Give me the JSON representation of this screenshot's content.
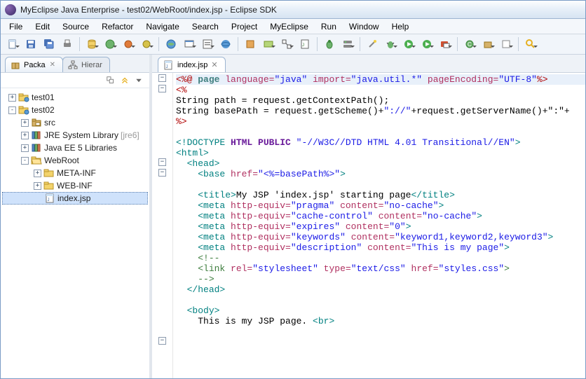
{
  "title": "MyEclipse Java Enterprise - test02/WebRoot/index.jsp - Eclipse SDK",
  "menu": [
    "File",
    "Edit",
    "Source",
    "Refactor",
    "Navigate",
    "Search",
    "Project",
    "MyEclipse",
    "Run",
    "Window",
    "Help"
  ],
  "sidebar": {
    "tabs": [
      {
        "label": "Packa",
        "icon": "package"
      },
      {
        "label": "Hierar",
        "icon": "hierarchy"
      }
    ],
    "tree": [
      {
        "depth": 0,
        "twisty": "+",
        "icon": "project",
        "label": "test01"
      },
      {
        "depth": 0,
        "twisty": "-",
        "icon": "project",
        "label": "test02"
      },
      {
        "depth": 1,
        "twisty": "+",
        "icon": "src",
        "label": "src"
      },
      {
        "depth": 1,
        "twisty": "+",
        "icon": "lib",
        "label": "JRE System Library",
        "suffix": "[jre6]"
      },
      {
        "depth": 1,
        "twisty": "+",
        "icon": "lib",
        "label": "Java EE 5 Libraries"
      },
      {
        "depth": 1,
        "twisty": "-",
        "icon": "folder-open",
        "label": "WebRoot"
      },
      {
        "depth": 2,
        "twisty": "+",
        "icon": "folder",
        "label": "META-INF"
      },
      {
        "depth": 2,
        "twisty": "+",
        "icon": "folder",
        "label": "WEB-INF"
      },
      {
        "depth": 2,
        "twisty": "",
        "icon": "jsp",
        "label": "index.jsp",
        "selected": true
      }
    ]
  },
  "editor": {
    "tab": {
      "label": "index.jsp",
      "icon": "jsp"
    },
    "folds": [
      "-",
      "-",
      "",
      "",
      "",
      "",
      "",
      "",
      "-",
      "-",
      "",
      "",
      "",
      "",
      "",
      "",
      "",
      "",
      "",
      "",
      "",
      "",
      "",
      "",
      "",
      "-",
      ""
    ],
    "lines": [
      {
        "hl": true,
        "segs": [
          [
            "<%@ ",
            "t-red"
          ],
          [
            "page ",
            "t-dir"
          ],
          [
            "language=",
            "t-attr"
          ],
          [
            "\"java\" ",
            "t-str"
          ],
          [
            "import=",
            "t-attr"
          ],
          [
            "\"java.util.*\" ",
            "t-str"
          ],
          [
            "pageEncoding=",
            "t-attr"
          ],
          [
            "\"UTF-8\"",
            "t-str"
          ],
          [
            "%>",
            "t-red"
          ]
        ]
      },
      {
        "segs": [
          [
            "<%",
            "t-red"
          ]
        ]
      },
      {
        "segs": [
          [
            "String path = request.getContextPath();",
            ""
          ]
        ]
      },
      {
        "segs": [
          [
            "String basePath = request.getScheme()+",
            ""
          ],
          [
            "\"://\"",
            "t-str"
          ],
          [
            "+request.getServerName()+",
            ""
          ],
          [
            "\":\"+",
            ""
          ]
        ]
      },
      {
        "segs": [
          [
            "%>",
            "t-red"
          ]
        ]
      },
      {
        "segs": [
          [
            "",
            ""
          ]
        ]
      },
      {
        "segs": [
          [
            "<!DOCTYPE ",
            "t-tag"
          ],
          [
            "HTML PUBLIC ",
            "t-key"
          ],
          [
            "\"-//W3C//DTD HTML 4.01 Transitional//EN\"",
            "t-str"
          ],
          [
            ">",
            "t-tag"
          ]
        ]
      },
      {
        "segs": [
          [
            "<html>",
            "t-tag"
          ]
        ]
      },
      {
        "segs": [
          [
            "  ",
            ""
          ],
          [
            "<head>",
            "t-tag"
          ]
        ]
      },
      {
        "segs": [
          [
            "    ",
            ""
          ],
          [
            "<base ",
            "t-tag"
          ],
          [
            "href=",
            "t-attr"
          ],
          [
            "\"<%=basePath%>\"",
            "t-str"
          ],
          [
            ">",
            "t-tag"
          ]
        ]
      },
      {
        "segs": [
          [
            "    ",
            ""
          ]
        ]
      },
      {
        "segs": [
          [
            "    ",
            ""
          ],
          [
            "<title>",
            "t-tag"
          ],
          [
            "My JSP 'index.jsp' starting page",
            ""
          ],
          [
            "</title>",
            "t-tag"
          ]
        ]
      },
      {
        "segs": [
          [
            "    ",
            ""
          ],
          [
            "<meta ",
            "t-tag"
          ],
          [
            "http-equiv=",
            "t-attr"
          ],
          [
            "\"pragma\" ",
            "t-str"
          ],
          [
            "content=",
            "t-attr"
          ],
          [
            "\"no-cache\"",
            "t-str"
          ],
          [
            ">",
            "t-tag"
          ]
        ]
      },
      {
        "segs": [
          [
            "    ",
            ""
          ],
          [
            "<meta ",
            "t-tag"
          ],
          [
            "http-equiv=",
            "t-attr"
          ],
          [
            "\"cache-control\" ",
            "t-str"
          ],
          [
            "content=",
            "t-attr"
          ],
          [
            "\"no-cache\"",
            "t-str"
          ],
          [
            ">",
            "t-tag"
          ]
        ]
      },
      {
        "segs": [
          [
            "    ",
            ""
          ],
          [
            "<meta ",
            "t-tag"
          ],
          [
            "http-equiv=",
            "t-attr"
          ],
          [
            "\"expires\" ",
            "t-str"
          ],
          [
            "content=",
            "t-attr"
          ],
          [
            "\"0\"",
            "t-str"
          ],
          [
            ">    ",
            "t-tag"
          ]
        ]
      },
      {
        "segs": [
          [
            "    ",
            ""
          ],
          [
            "<meta ",
            "t-tag"
          ],
          [
            "http-equiv=",
            "t-attr"
          ],
          [
            "\"keywords\" ",
            "t-str"
          ],
          [
            "content=",
            "t-attr"
          ],
          [
            "\"keyword1,keyword2,keyword3\"",
            "t-str"
          ],
          [
            ">",
            "t-tag"
          ]
        ]
      },
      {
        "segs": [
          [
            "    ",
            ""
          ],
          [
            "<meta ",
            "t-tag"
          ],
          [
            "http-equiv=",
            "t-attr"
          ],
          [
            "\"description\" ",
            "t-str"
          ],
          [
            "content=",
            "t-attr"
          ],
          [
            "\"This is my page\"",
            "t-str"
          ],
          [
            ">",
            "t-tag"
          ]
        ]
      },
      {
        "segs": [
          [
            "    ",
            ""
          ],
          [
            "<!--",
            "t-comment"
          ]
        ]
      },
      {
        "segs": [
          [
            "    ",
            ""
          ],
          [
            "<link ",
            "t-comment"
          ],
          [
            "rel=",
            "t-attr"
          ],
          [
            "\"stylesheet\" ",
            "t-str"
          ],
          [
            "type=",
            "t-attr"
          ],
          [
            "\"text/css\" ",
            "t-str"
          ],
          [
            "href=",
            "t-attr"
          ],
          [
            "\"styles.css\"",
            "t-str"
          ],
          [
            ">",
            "t-comment"
          ]
        ]
      },
      {
        "segs": [
          [
            "    ",
            ""
          ],
          [
            "-->",
            "t-comment"
          ]
        ]
      },
      {
        "segs": [
          [
            "  ",
            ""
          ],
          [
            "</head>",
            "t-tag"
          ]
        ]
      },
      {
        "segs": [
          [
            "  ",
            ""
          ]
        ]
      },
      {
        "segs": [
          [
            "  ",
            ""
          ],
          [
            "<body>",
            "t-tag"
          ]
        ]
      },
      {
        "segs": [
          [
            "    This is my JSP page. ",
            ""
          ],
          [
            "<br>",
            "t-tag"
          ]
        ]
      }
    ]
  }
}
